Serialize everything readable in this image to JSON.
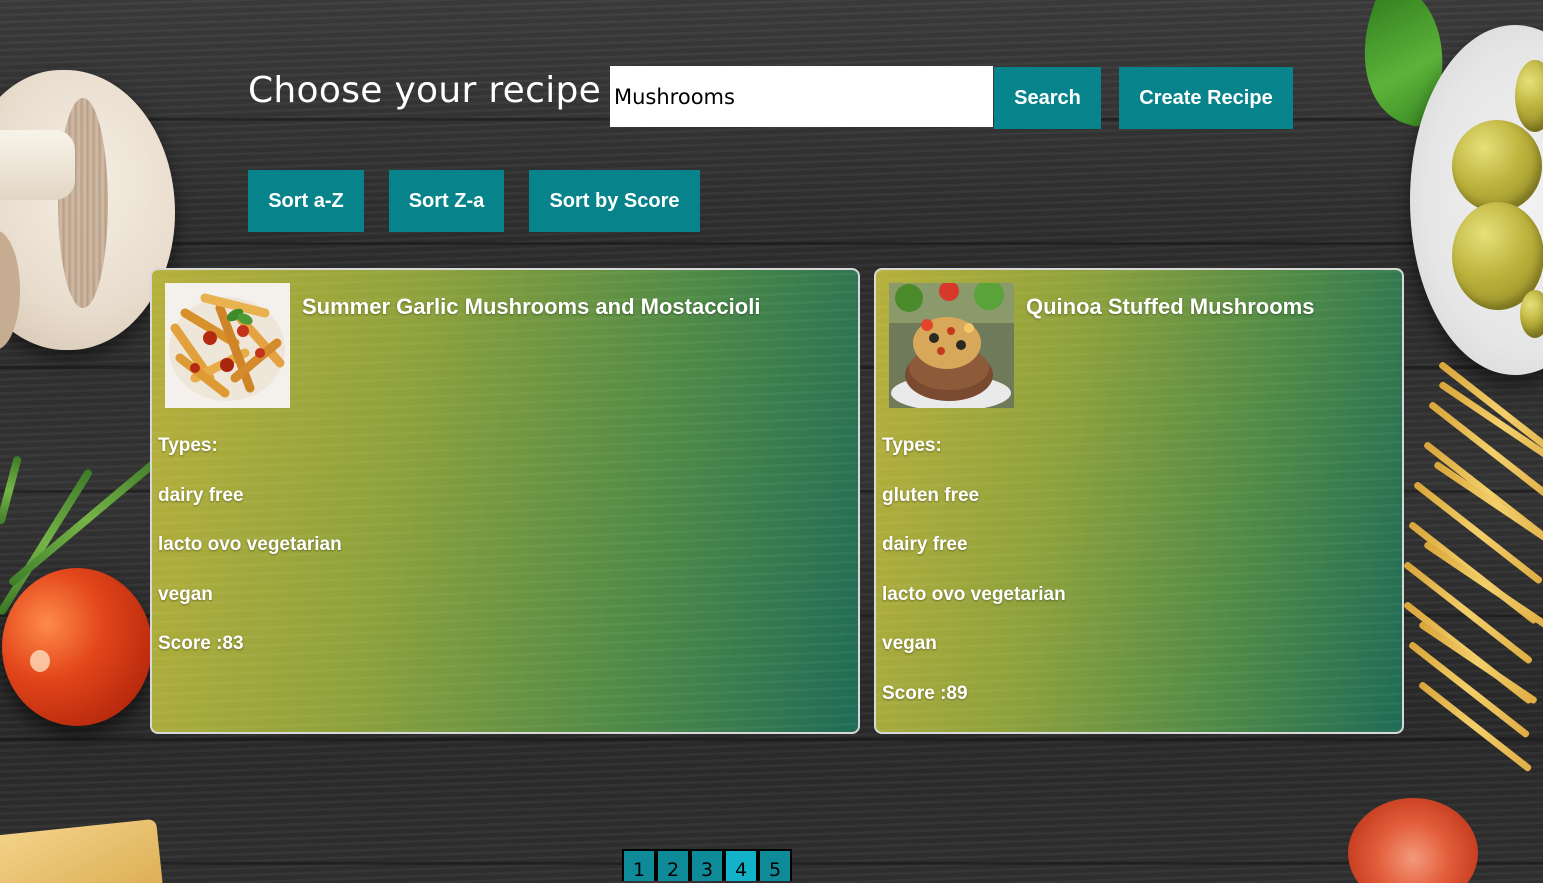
{
  "header": {
    "title": "Choose your recipe",
    "search_value": "Mushrooms",
    "search_button": "Search",
    "create_button": "Create Recipe"
  },
  "sort_buttons": {
    "az": "Sort a-Z",
    "za": "Sort Z-a",
    "score": "Sort by Score"
  },
  "recipes": [
    {
      "title": "Summer Garlic Mushrooms and Mostaccioli",
      "image": "penne-pasta-photo",
      "types_label": "Types:",
      "types": [
        "dairy free",
        "lacto ovo vegetarian",
        "vegan"
      ],
      "score_label": "Score :83"
    },
    {
      "title": "Quinoa Stuffed Mushrooms",
      "image": "stuffed-mushroom-photo",
      "types_label": "Types:",
      "types": [
        "gluten free",
        "dairy free",
        "lacto ovo vegetarian",
        "vegan"
      ],
      "score_label": "Score :89"
    }
  ],
  "pagination": {
    "pages": [
      "1",
      "2",
      "3",
      "4",
      "5"
    ],
    "current": "4"
  },
  "colors": {
    "button_bg": "#07838b",
    "page_button": "#0f8a98",
    "page_button_active": "#12b3c8"
  }
}
